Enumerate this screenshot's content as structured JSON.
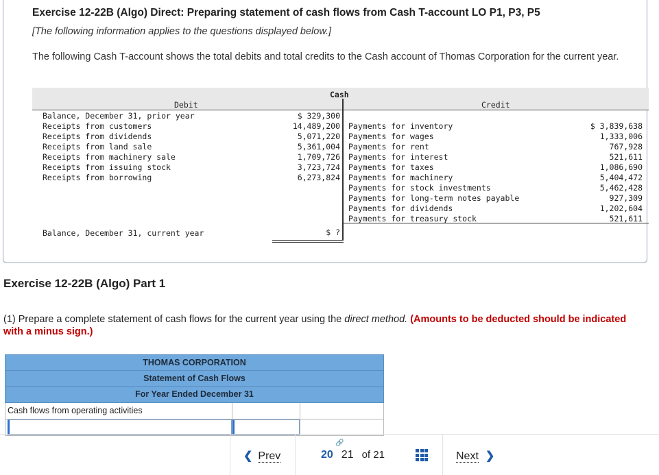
{
  "exercise": {
    "title": "Exercise 12-22B (Algo) Direct: Preparing statement of cash flows from Cash T-account LO P1, P3, P5",
    "subtitle": "[The following information applies to the questions displayed below.]",
    "description": "The following Cash T-account shows the total debits and total credits to the Cash account of Thomas Corporation for the current year."
  },
  "t_account": {
    "title": "Cash",
    "debit_header": "Debit",
    "credit_header": "Credit",
    "debits": [
      {
        "label": "Balance, December 31, prior year",
        "value": "$ 329,300"
      },
      {
        "label": "Receipts from customers",
        "value": "14,489,200"
      },
      {
        "label": "Receipts from dividends",
        "value": "5,071,220"
      },
      {
        "label": "Receipts from land sale",
        "value": "5,361,004"
      },
      {
        "label": "Receipts from machinery sale",
        "value": "1,709,726"
      },
      {
        "label": "Receipts from issuing stock",
        "value": "3,723,724"
      },
      {
        "label": "Receipts from borrowing",
        "value": "6,273,824"
      }
    ],
    "credits": [
      {
        "label": "Payments for inventory",
        "value": "$ 3,839,638"
      },
      {
        "label": "Payments for wages",
        "value": "1,333,006"
      },
      {
        "label": "Payments for rent",
        "value": "767,928"
      },
      {
        "label": "Payments for interest",
        "value": "521,611"
      },
      {
        "label": "Payments for taxes",
        "value": "1,086,690"
      },
      {
        "label": "Payments for machinery",
        "value": "5,404,472"
      },
      {
        "label": "Payments for stock investments",
        "value": "5,462,428"
      },
      {
        "label": "Payments for long-term notes payable",
        "value": "927,309"
      },
      {
        "label": "Payments for dividends",
        "value": "1,202,604"
      },
      {
        "label": "Payments for treasury stock",
        "value": "521,611"
      }
    ],
    "ending_label": "Balance, December 31, current year",
    "ending_value": "$ ?"
  },
  "part": {
    "title": "Exercise 12-22B (Algo) Part 1",
    "question_prefix": "(1) Prepare a complete statement of cash flows for the current year using the ",
    "question_emphasis": "direct method.",
    "question_instruction": "(Amounts to be deducted should be indicated with a minus sign.)"
  },
  "statement": {
    "company": "THOMAS CORPORATION",
    "name": "Statement of Cash Flows",
    "period": "For Year Ended December 31",
    "section_label": "Cash flows from operating activities"
  },
  "nav": {
    "prev_label": "Prev",
    "current_page": "20",
    "next_page": "21",
    "of_label": "of 21",
    "next_label": "Next"
  }
}
